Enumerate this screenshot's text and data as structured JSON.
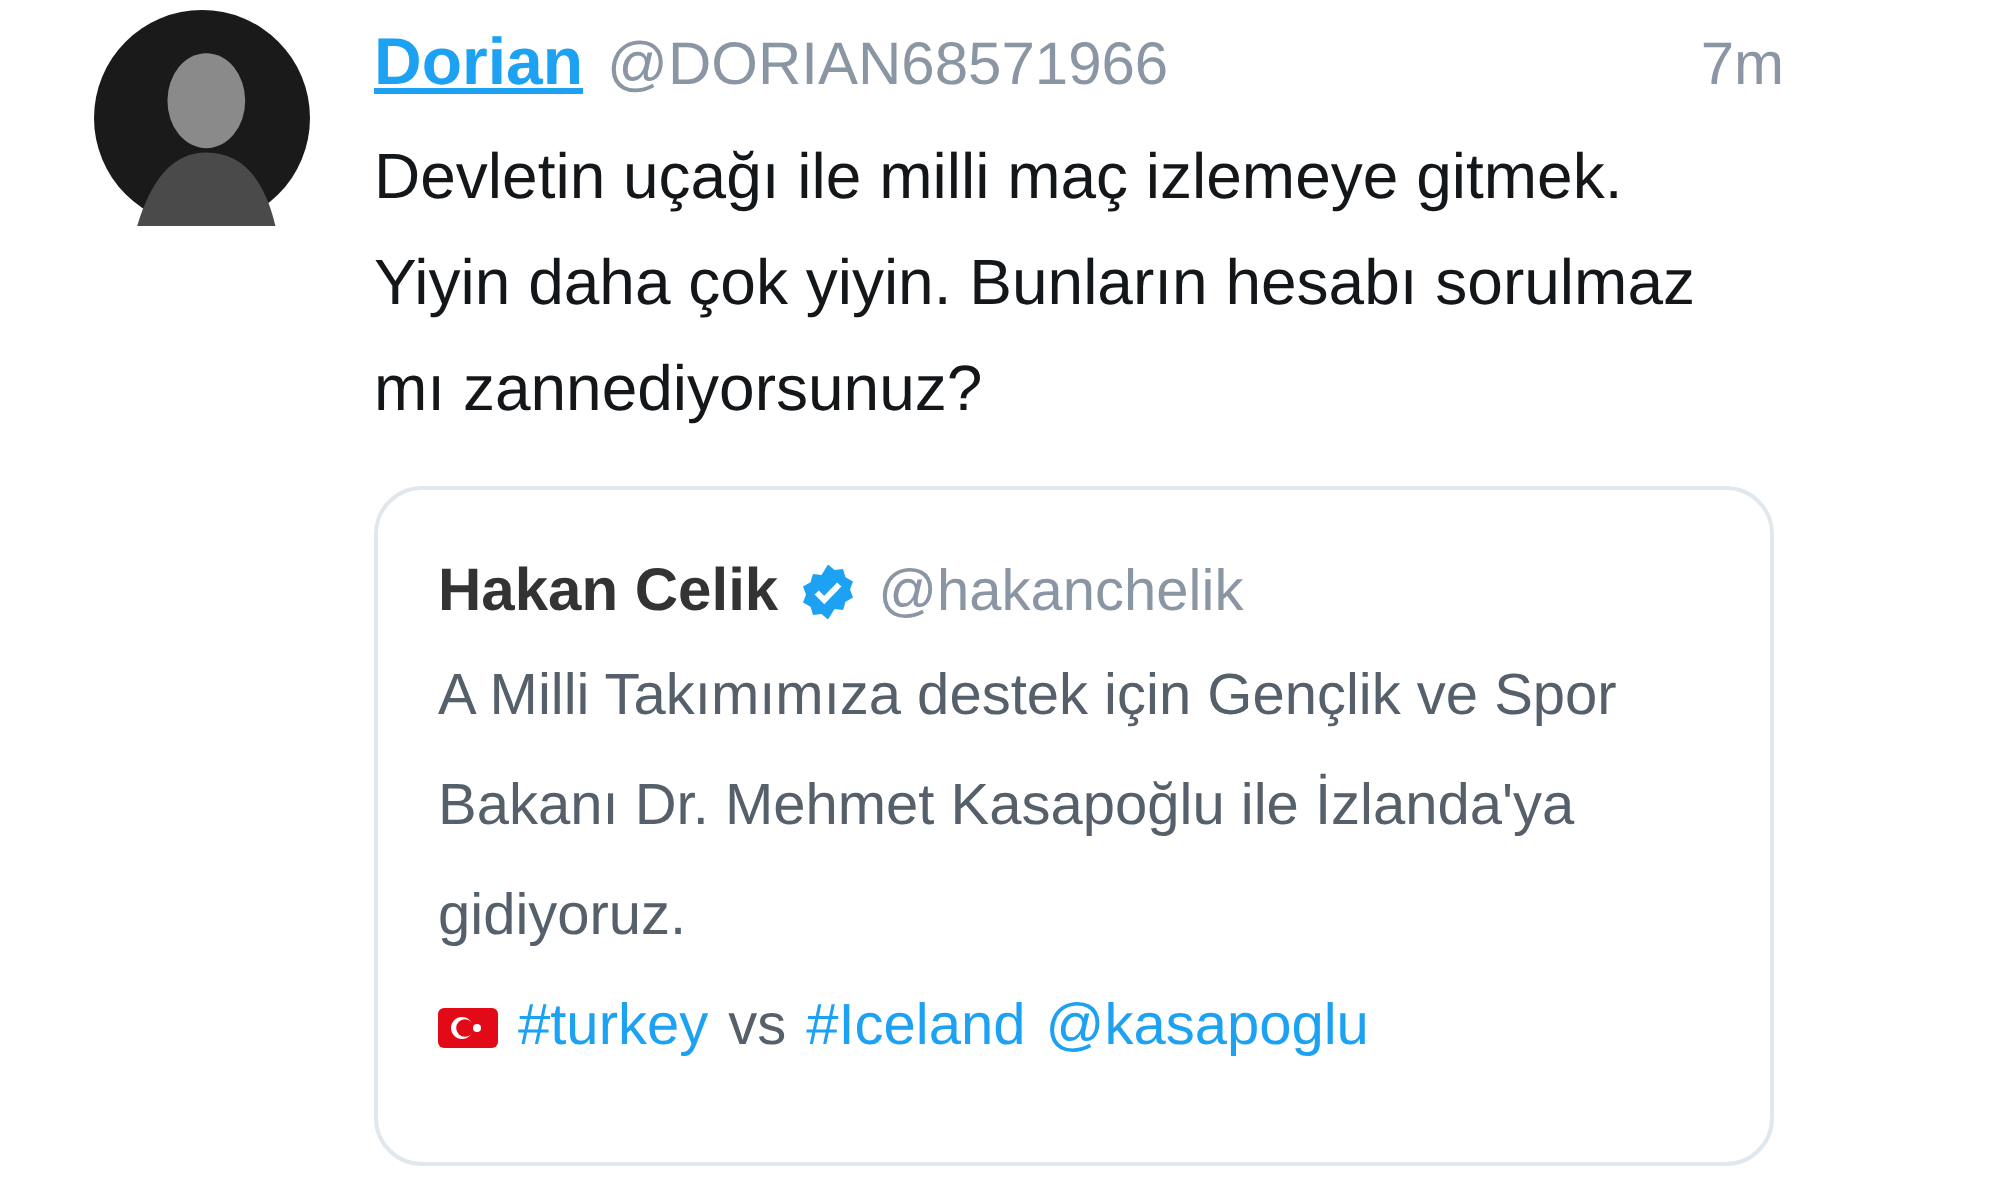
{
  "tweet": {
    "name": "Dorian",
    "handle": "@DORIAN68571966",
    "time": "7m",
    "text": "Devletin uçağı ile milli maç izlemeye gitmek.\nYiyin daha çok yiyin. Bunların hesabı sorulmaz mı zannediyorsunuz?"
  },
  "quote": {
    "name": "Hakan Celik",
    "verified": true,
    "handle": "@hakanchelik",
    "text": "A Milli Takımımıza destek için Gençlik ve Spor Bakanı Dr. Mehmet Kasapoğlu ile  İzlanda'ya gidiyoruz.",
    "tags": [
      {
        "kind": "link",
        "text": "#turkey"
      },
      {
        "kind": "text",
        "text": "vs"
      },
      {
        "kind": "link",
        "text": "#Iceland"
      },
      {
        "kind": "link",
        "text": "@kasapoglu"
      }
    ]
  }
}
